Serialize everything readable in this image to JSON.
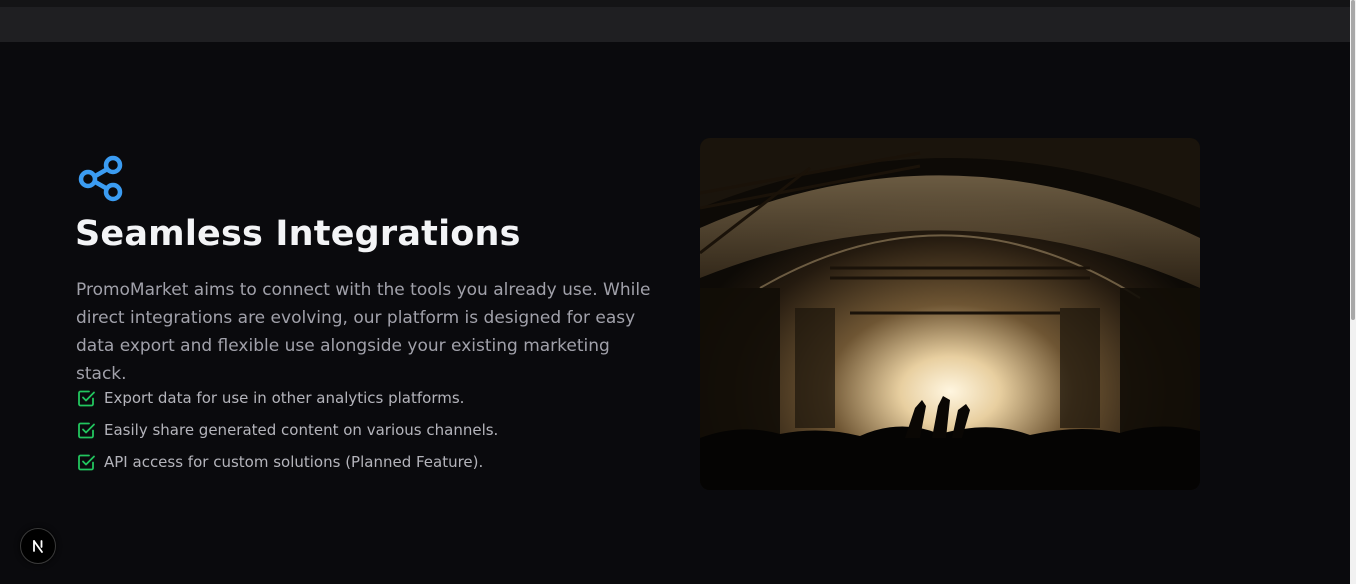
{
  "feature_section": {
    "icon": "share-icon",
    "title": "Seamless Integrations",
    "description": "PromoMarket aims to connect with the tools you already use. While direct integrations are evolving, our platform is designed for easy data export and flexible use alongside your existing marketing stack.",
    "features": [
      {
        "icon": "check-square-icon",
        "text": "Export data for use in other analytics platforms."
      },
      {
        "icon": "check-square-icon",
        "text": "Easily share generated content on various channels."
      },
      {
        "icon": "check-square-icon",
        "text": "API access for custom solutions (Planned Feature)."
      }
    ],
    "image": "concert-crowd-photo"
  },
  "colors": {
    "accent_blue": "#3b9cf2",
    "check_green": "#22c55e",
    "background": "#0a0a0d"
  },
  "dev_badge": {
    "label": "N",
    "icon": "nextjs-logo-icon"
  }
}
